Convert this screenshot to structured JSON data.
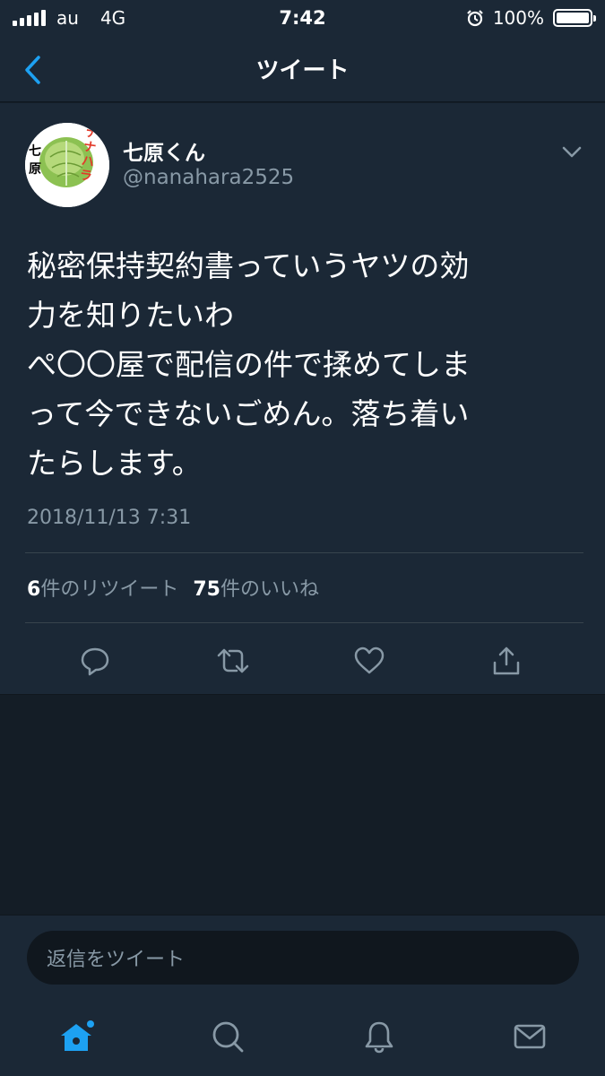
{
  "status_bar": {
    "carrier": "au",
    "network": "4G",
    "time": "7:42",
    "battery": "100%",
    "battery_level": 1.0
  },
  "nav": {
    "title": "ツイート"
  },
  "tweet": {
    "author_name": "七原くん",
    "author_handle": "@nanahara2525",
    "avatar_text_left": "七原",
    "avatar_text_right": "ナナハラ",
    "text_lines": [
      "秘密保持契約書っていうヤツの効",
      "力を知りたいわ",
      "ぺ〇〇屋で配信の件で揉めてしま",
      "って今できないごめん。落ち着い",
      "たらします。"
    ],
    "timestamp": "2018/11/13 7:31",
    "retweet_count": "6",
    "retweet_label": "件のリツイート",
    "like_count": "75",
    "like_label": "件のいいね"
  },
  "reply": {
    "placeholder": "返信をツイート"
  },
  "colors": {
    "background": "#141d26",
    "card": "#1b2836",
    "secondary_text": "#8899a6",
    "accent": "#1da1f2",
    "divider": "#38444d"
  },
  "icons": {
    "back": "chevron-left-icon",
    "caret": "chevron-down-icon",
    "reply": "reply-icon",
    "retweet": "retweet-icon",
    "like": "heart-icon",
    "share": "share-icon",
    "home": "home-icon",
    "search": "search-icon",
    "notifications": "bell-icon",
    "messages": "mail-icon"
  }
}
